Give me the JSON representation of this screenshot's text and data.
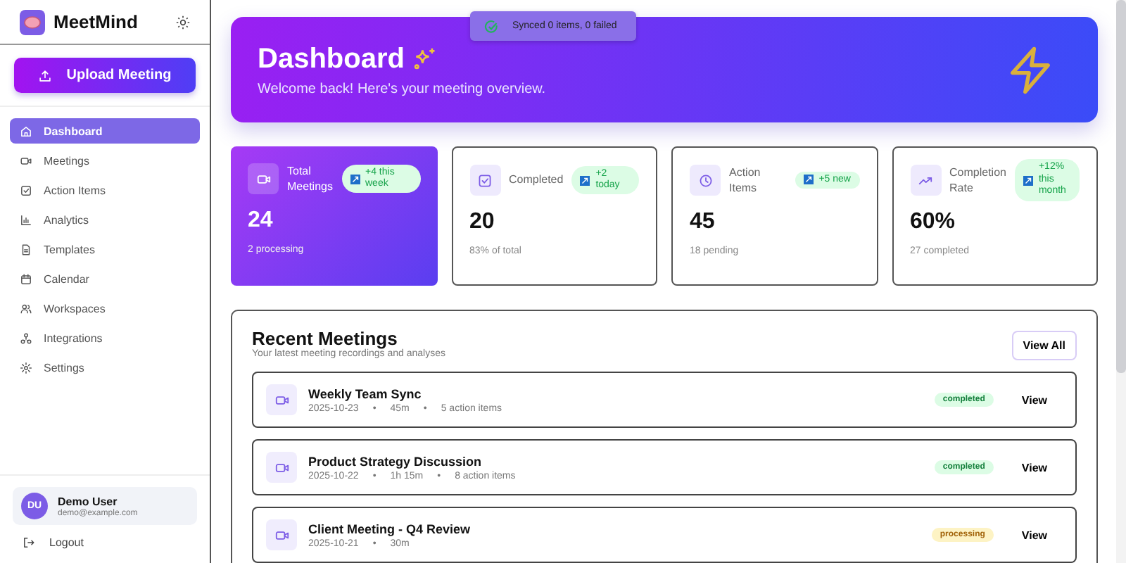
{
  "sidebar": {
    "app_name": "MeetMind",
    "upload_button": "Upload Meeting",
    "items": [
      {
        "label": "Dashboard",
        "selected": true
      },
      {
        "label": "Meetings",
        "selected": false
      },
      {
        "label": "Action Items",
        "selected": false
      },
      {
        "label": "Analytics",
        "selected": false
      },
      {
        "label": "Templates",
        "selected": false
      },
      {
        "label": "Calendar",
        "selected": false
      },
      {
        "label": "Workspaces",
        "selected": false
      },
      {
        "label": "Integrations",
        "selected": false
      },
      {
        "label": "Settings",
        "selected": false
      }
    ],
    "user": {
      "initials": "DU",
      "name": "Demo User",
      "email": "demo@example.com"
    },
    "logout": "Logout"
  },
  "toast": "Synced 0 items, 0 failed",
  "banner": {
    "title": "Dashboard",
    "subtitle": "Welcome back! Here's your meeting overview."
  },
  "stats": [
    {
      "label": "Total Meetings",
      "badge": "+4 this week",
      "value": "24",
      "note": "2 processing",
      "highlighted": true
    },
    {
      "label": "Completed",
      "badge": "+2 today",
      "value": "20",
      "note": "83% of total",
      "highlighted": false
    },
    {
      "label": "Action Items",
      "badge": "+5 new",
      "value": "45",
      "note": "18 pending",
      "highlighted": false
    },
    {
      "label": "Completion Rate",
      "badge": "+12% this month",
      "value": "60%",
      "note": "27 completed",
      "highlighted": false
    }
  ],
  "recent": {
    "title": "Recent Meetings",
    "subtitle": "Your latest meeting recordings and analyses",
    "view_all": "View All",
    "separator": "•",
    "meetings": [
      {
        "title": "Weekly Team Sync",
        "meta": [
          "2025-10-23",
          "45m",
          "5 action items"
        ],
        "status": "completed",
        "action": "View"
      },
      {
        "title": "Product Strategy Discussion",
        "meta": [
          "2025-10-22",
          "1h 15m",
          "8 action items"
        ],
        "status": "completed",
        "action": "View"
      },
      {
        "title": "Client Meeting - Q4 Review",
        "meta": [
          "2025-10-21",
          "30m"
        ],
        "status": "processing",
        "action": "View"
      }
    ]
  }
}
